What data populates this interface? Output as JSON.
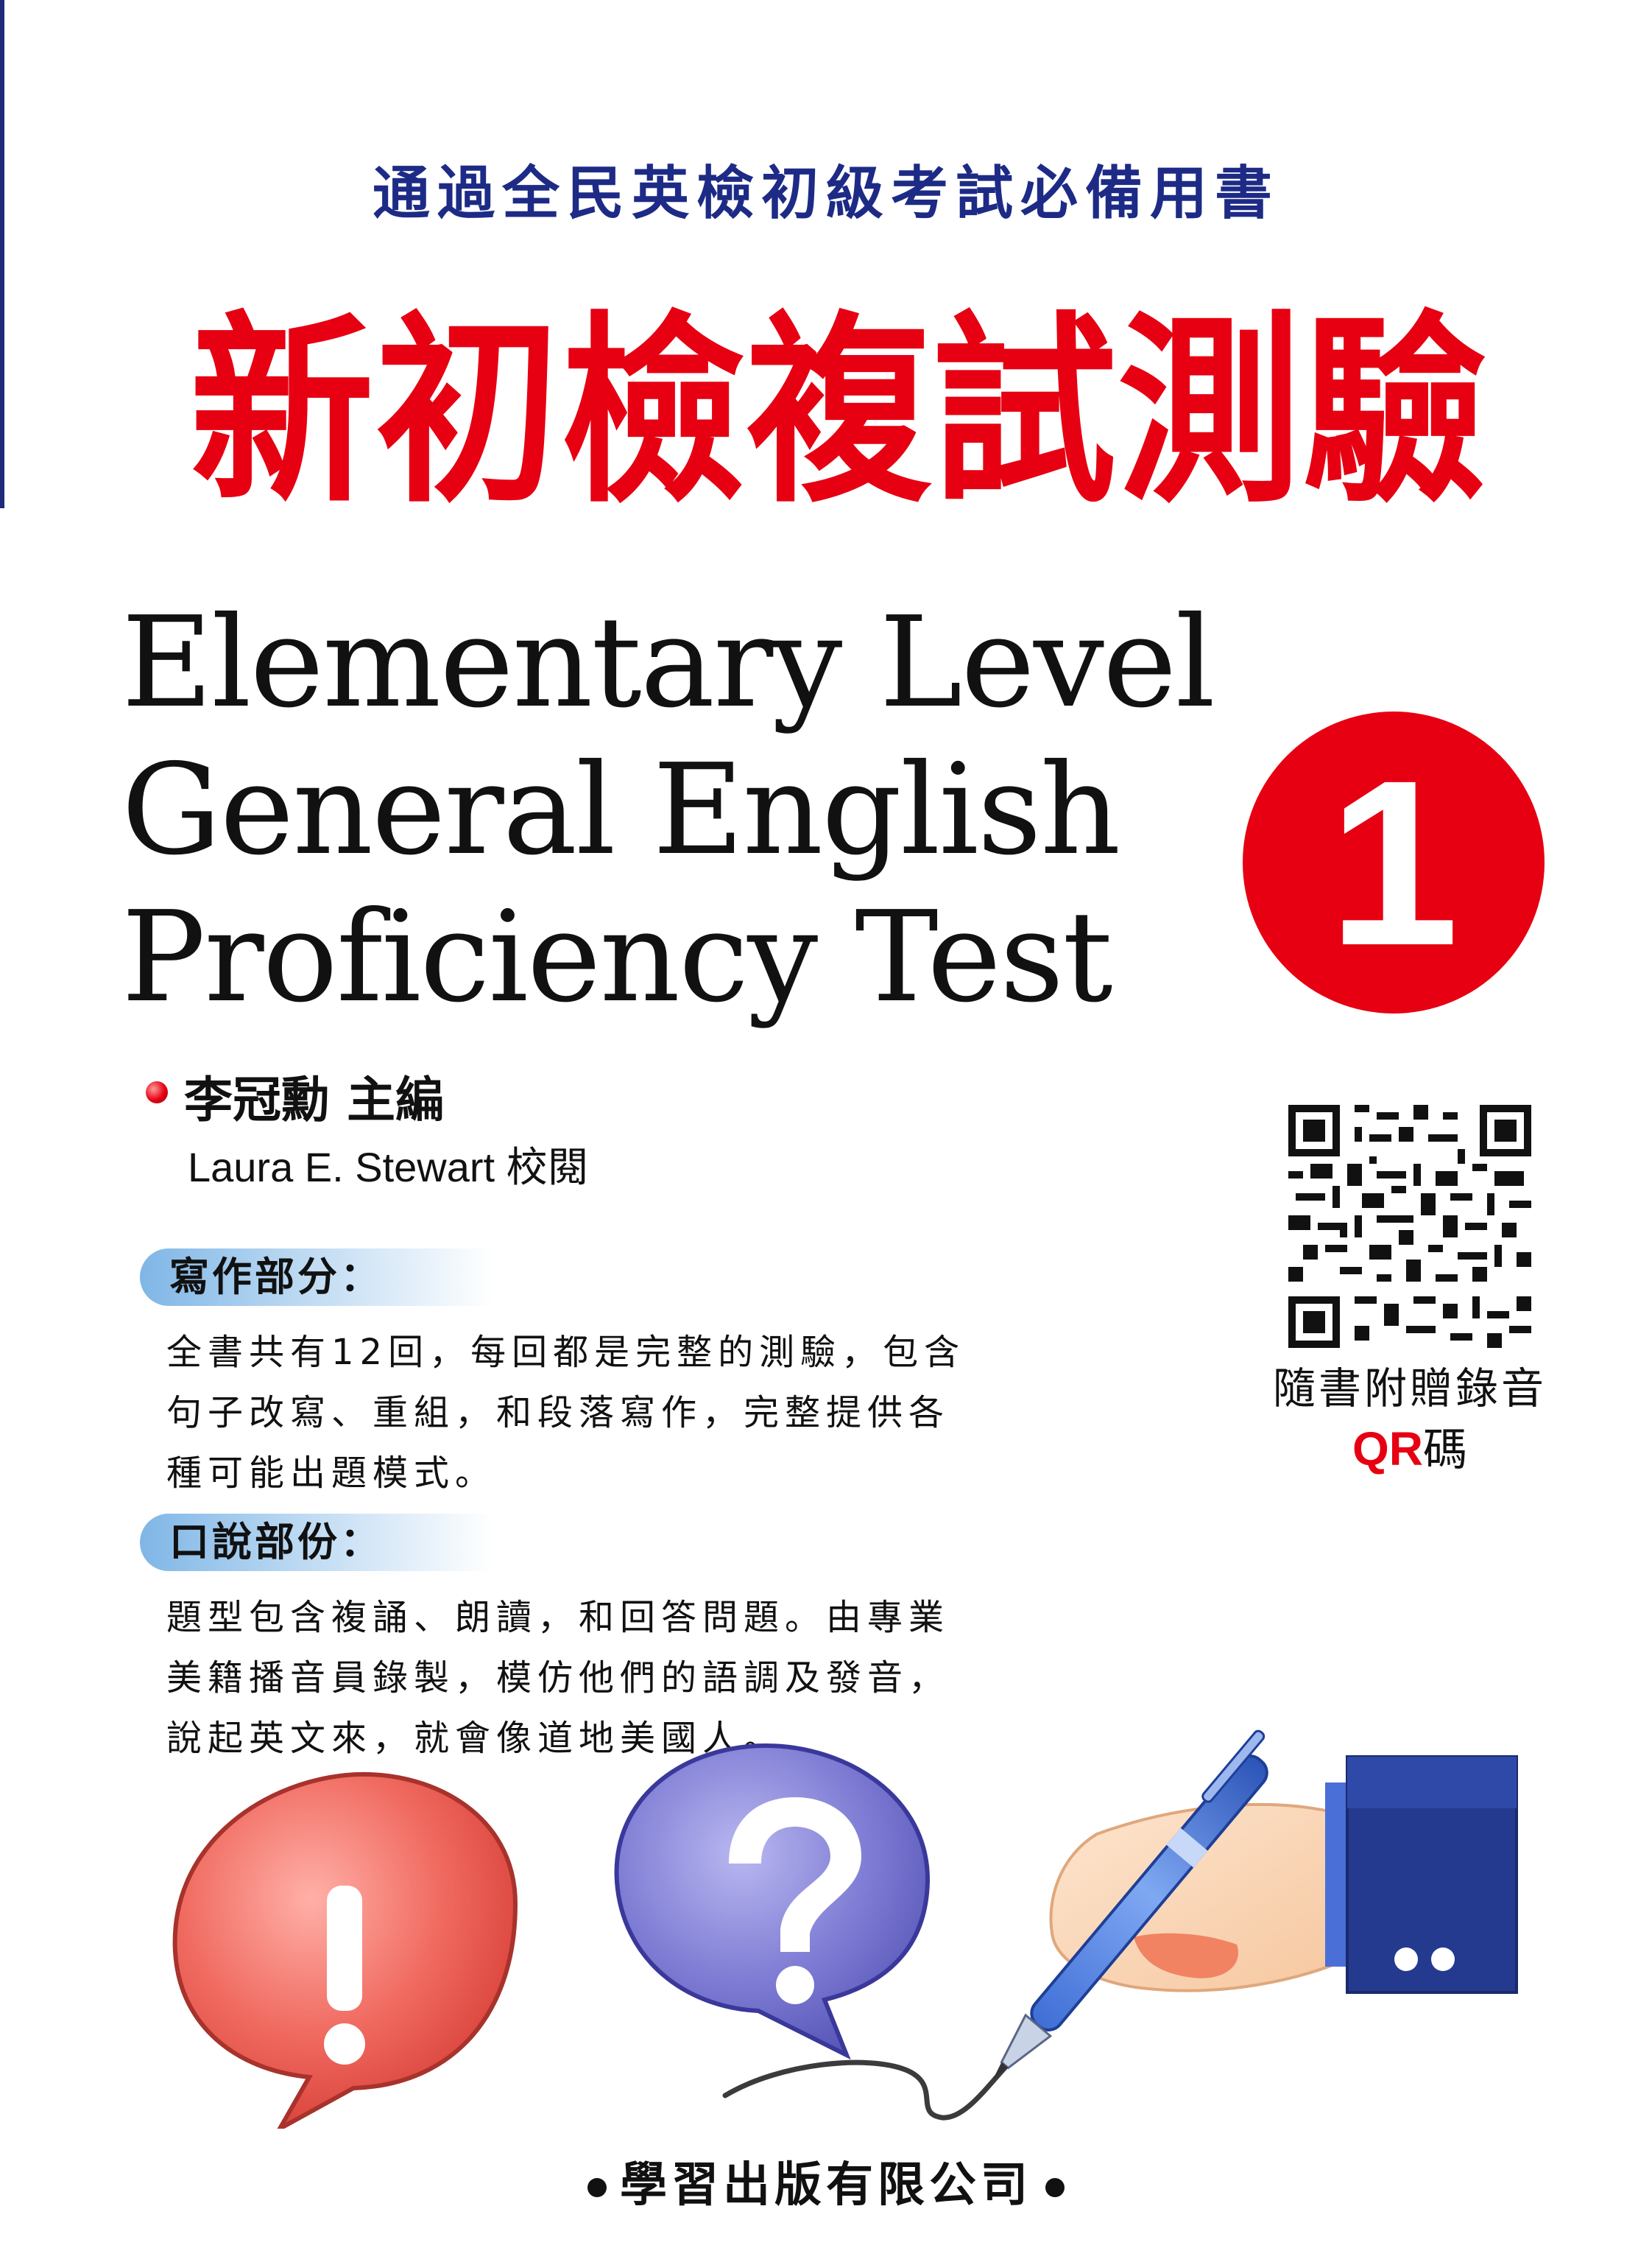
{
  "cover": {
    "tagline": "通過全民英檢初級考試必備用書",
    "main_title": "新初檢複試測驗",
    "english_title": {
      "line1": "Elementary Level",
      "line2": "General English",
      "line3": "Proficiency Test"
    },
    "volume_number": "1",
    "editor": "李冠勳 主編",
    "reviewer": "Laura E. Stewart 校閱",
    "writing_section": {
      "label": "寫作部分：",
      "body": "全書共有12回，每回都是完整的測驗，包含\n句子改寫、重組，和段落寫作，完整提供各\n種可能出題模式。"
    },
    "speaking_section": {
      "label": "口說部份：",
      "body": "題型包含複誦、朗讀，和回答問題。由專業\n美籍播音員錄製，模仿他們的語調及發音，\n說起英文來，就會像道地美國人。"
    },
    "qr": {
      "caption": "隨書附贈錄音",
      "label_qr": "QR",
      "label_suffix": "碼"
    },
    "illustration": {
      "exclamation": "!",
      "question": "?"
    },
    "publisher": "學習出版有限公司"
  },
  "colors": {
    "title_red": "#e60012",
    "tagline_blue": "#1d2b86",
    "label_blue": "#7fb6e6",
    "bubble_purple": "#6e6cc4",
    "sleeve_navy": "#243a8f"
  },
  "icons": [
    "editor-bullet-icon",
    "qr-code-icon",
    "speech-bubble-exclamation-icon",
    "speech-bubble-question-icon",
    "pen-icon",
    "hand-icon",
    "publisher-bullet-icon"
  ]
}
